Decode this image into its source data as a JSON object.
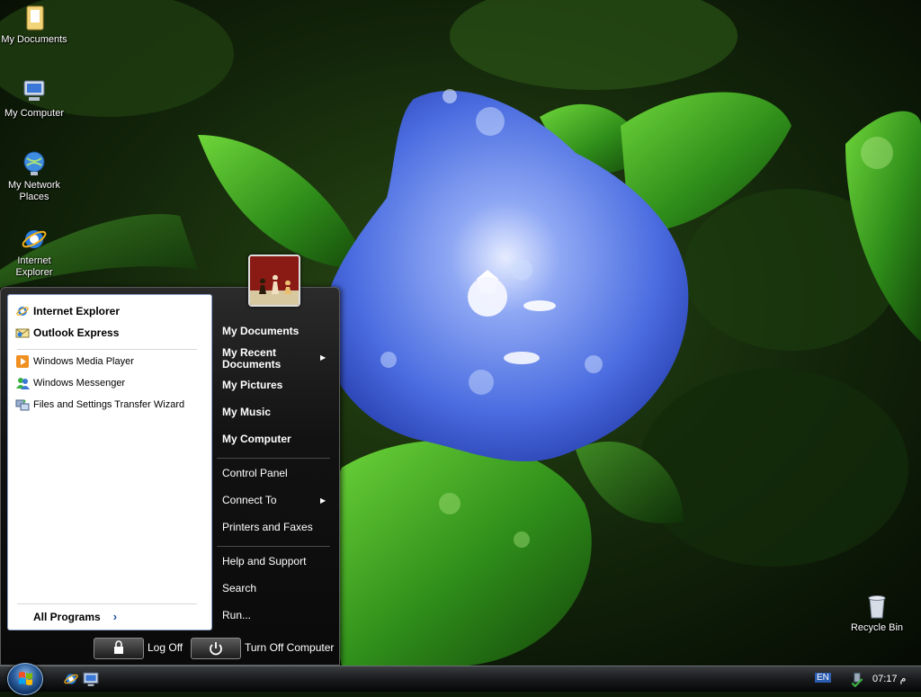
{
  "desktop": {
    "icons": [
      {
        "label": "My Documents"
      },
      {
        "label": "My Computer"
      },
      {
        "label": "My Network Places"
      },
      {
        "label": "Internet Explorer"
      },
      {
        "label": "Recycle Bin"
      }
    ]
  },
  "start_menu": {
    "pinned": [
      {
        "label": "Internet Explorer",
        "icon": "ie-icon"
      },
      {
        "label": "Outlook Express",
        "icon": "outlook-express-icon"
      }
    ],
    "recent": [
      {
        "label": "Windows Media Player",
        "icon": "media-player-icon"
      },
      {
        "label": "Windows Messenger",
        "icon": "messenger-icon"
      },
      {
        "label": "Files and Settings Transfer Wizard",
        "icon": "transfer-wizard-icon"
      }
    ],
    "all_programs": "All Programs",
    "places": [
      {
        "label": "My Documents"
      },
      {
        "label": "My Recent Documents"
      },
      {
        "label": "My Pictures"
      },
      {
        "label": "My Music"
      },
      {
        "label": "My Computer"
      }
    ],
    "system": [
      {
        "label": "Control Panel"
      },
      {
        "label": "Connect To"
      },
      {
        "label": "Printers and Faxes"
      }
    ],
    "help": [
      {
        "label": "Help and Support"
      },
      {
        "label": "Search"
      },
      {
        "label": "Run..."
      }
    ],
    "log_off": "Log Off",
    "turn_off": "Turn Off Computer"
  },
  "taskbar": {
    "language": "EN",
    "clock": "07:17 م"
  }
}
